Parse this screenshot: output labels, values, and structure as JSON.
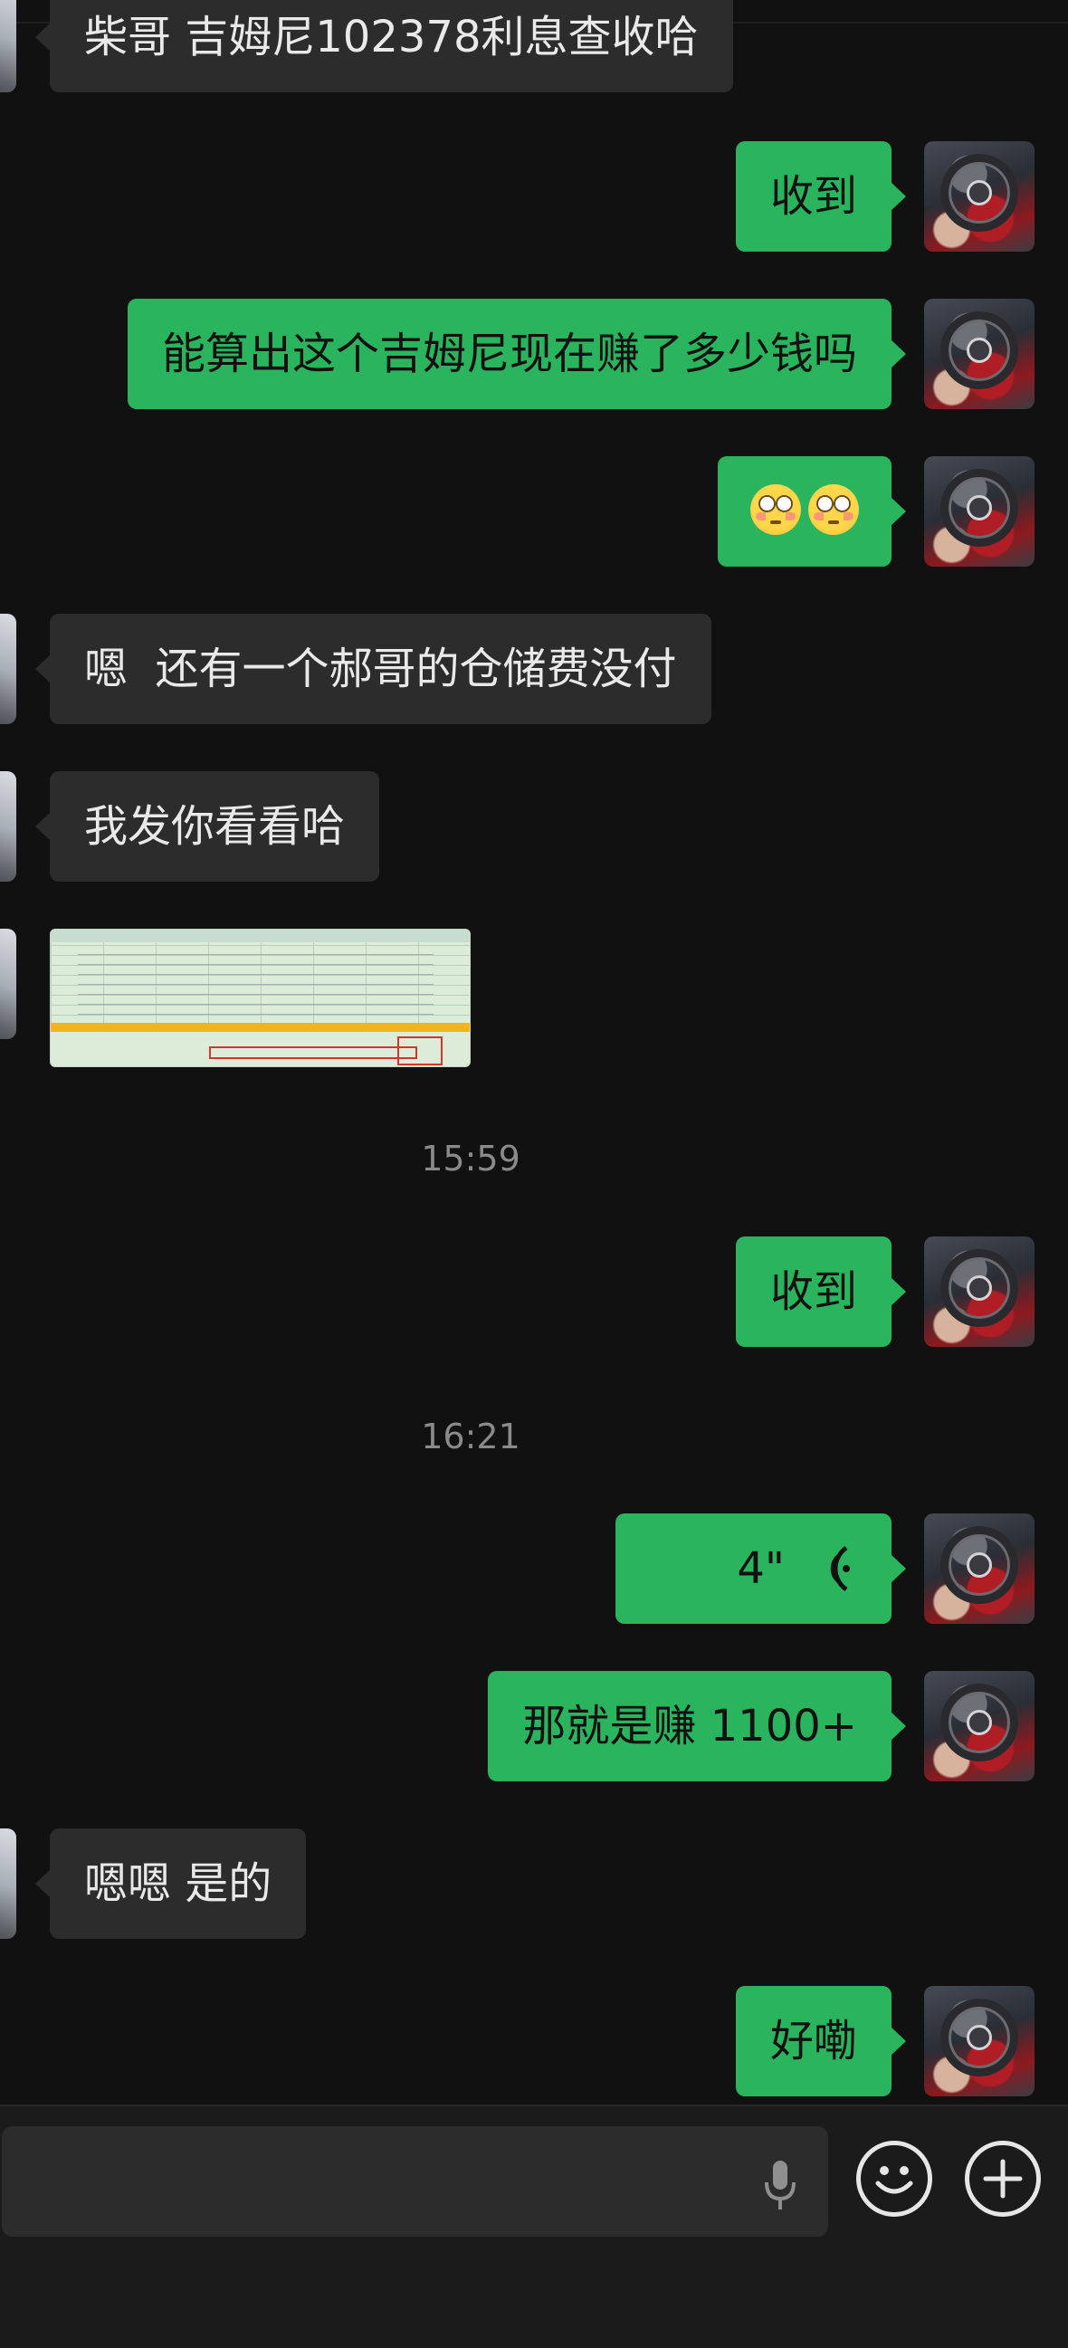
{
  "messages": [
    {
      "side": "in",
      "text": "柴哥 吉姆尼102378利息查收哈"
    },
    {
      "side": "out",
      "text": "收到"
    },
    {
      "side": "out",
      "text": "能算出这个吉姆尼现在赚了多少钱吗"
    },
    {
      "side": "out",
      "emoji": [
        "flushed-face",
        "flushed-face"
      ]
    },
    {
      "side": "in",
      "text": "嗯  还有一个郝哥的仓储费没付"
    },
    {
      "side": "in",
      "text": "我发你看看哈"
    },
    {
      "side": "in",
      "image": "spreadsheet-screenshot"
    },
    {
      "timestamp": "15:59"
    },
    {
      "side": "out",
      "text": "收到"
    },
    {
      "timestamp": "16:21"
    },
    {
      "side": "out",
      "voice_duration": "4\""
    },
    {
      "side": "out",
      "text": "那就是赚 1100+"
    },
    {
      "side": "in",
      "text": "嗯嗯 是的"
    },
    {
      "side": "out",
      "text": "好嘞"
    }
  ],
  "input_bar": {
    "text_value": "",
    "icons": [
      "microphone-icon",
      "emoji-icon",
      "plus-icon"
    ]
  },
  "colors": {
    "background": "#111111",
    "bubble_out": "#2bb45e",
    "bubble_in": "#2c2c2c",
    "timestamp": "#8a8a8a"
  }
}
